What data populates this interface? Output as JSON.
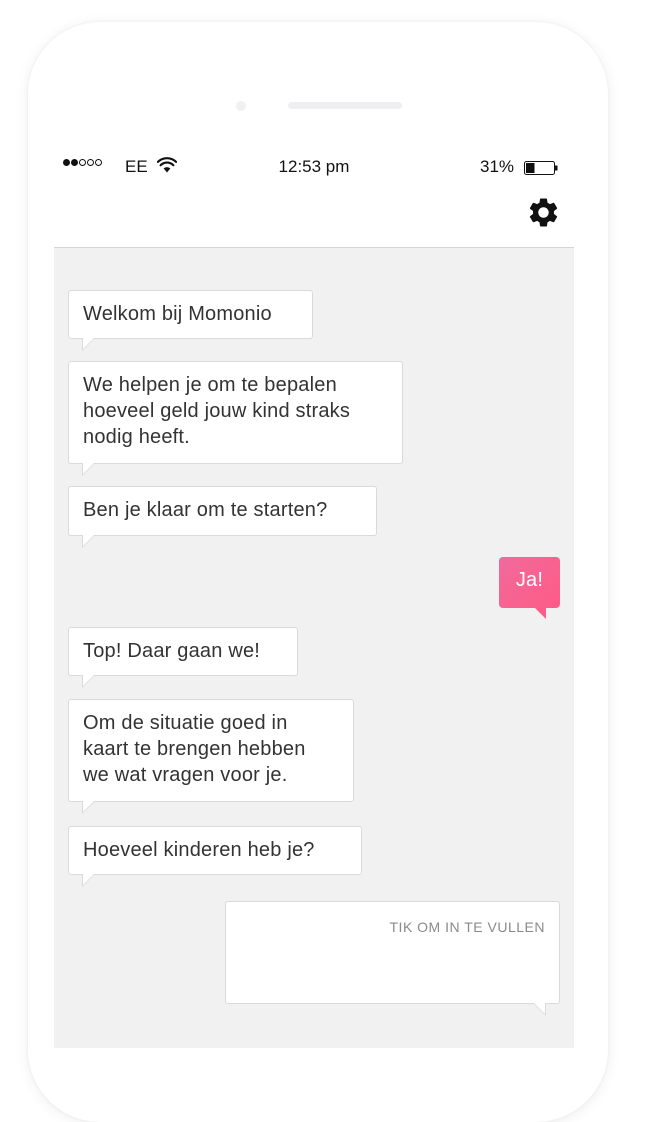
{
  "status_bar": {
    "carrier": "EE",
    "time": "12:53 pm",
    "battery": "31%",
    "signal_strength": 2,
    "signal_total": 5,
    "battery_level": 0.31
  },
  "nav": {
    "settings_icon": "gear-icon"
  },
  "chat": {
    "messages": [
      {
        "from": "bot",
        "text": "Welkom bij Momonio"
      },
      {
        "from": "bot",
        "text": "We helpen je om te bepalen\nhoeveel geld jouw kind straks\nnodig heeft."
      },
      {
        "from": "bot",
        "text": "Ben je klaar om te starten?"
      },
      {
        "from": "user",
        "text": "Ja!"
      },
      {
        "from": "bot",
        "text": "Top! Daar gaan we!"
      },
      {
        "from": "bot",
        "text": "Om de situatie goed in\nkaart te brengen hebben\nwe wat vragen voor je."
      },
      {
        "from": "bot",
        "text": "Hoeveel kinderen heb je?"
      }
    ],
    "input_hint": "TIK OM IN TE VULLEN"
  },
  "colors": {
    "accent": "#ff5b86",
    "chat_background": "#f1f1f1"
  }
}
